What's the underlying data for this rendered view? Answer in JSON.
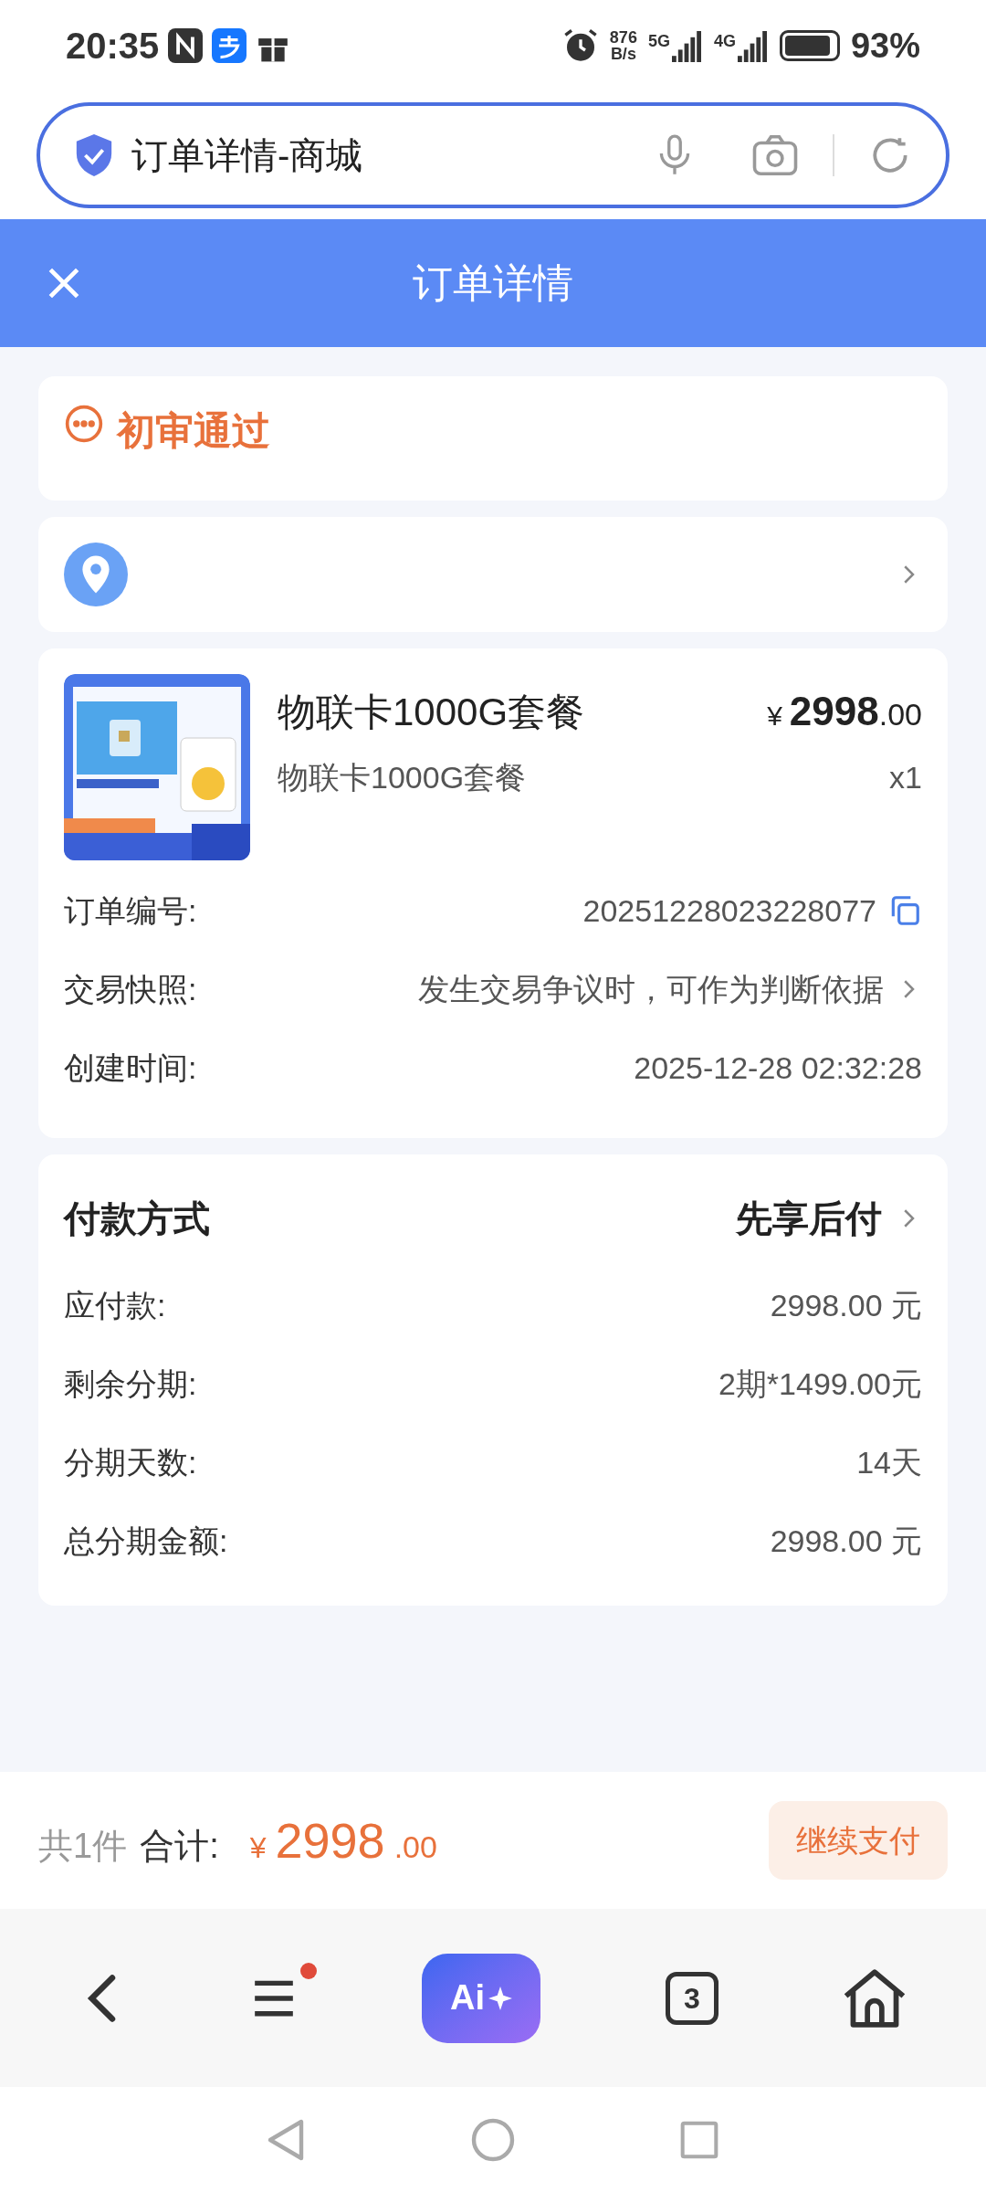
{
  "status_bar": {
    "time": "20:35",
    "net_speed": [
      "876",
      "B/s"
    ],
    "net1": "5G",
    "net2": "4G",
    "battery": "93%"
  },
  "address_bar": {
    "title": "订单详情-商城"
  },
  "header": {
    "title": "订单详情"
  },
  "status_card": {
    "text": "初审通过"
  },
  "product": {
    "name": "物联卡1000G套餐",
    "spec": "物联卡1000G套餐",
    "currency": "¥",
    "price_int": "2998",
    "price_dec": ".00",
    "qty": "x1"
  },
  "order_info": [
    {
      "label": "订单编号:",
      "value": "20251228023228077",
      "kind": "copy"
    },
    {
      "label": "交易快照:",
      "value": "发生交易争议时，可作为判断依据",
      "kind": "link"
    },
    {
      "label": "创建时间:",
      "value": "2025-12-28 02:32:28",
      "kind": "plain"
    }
  ],
  "payment": {
    "title": "付款方式",
    "method": "先享后付",
    "rows": [
      {
        "label": "应付款:",
        "value": "2998.00 元"
      },
      {
        "label": "剩余分期:",
        "value": "2期*1499.00元"
      },
      {
        "label": "分期天数:",
        "value": "14天"
      },
      {
        "label": "总分期金额:",
        "value": "2998.00 元"
      }
    ]
  },
  "footer": {
    "count": "共1件",
    "total_label": "合计:",
    "currency": "¥",
    "total_int": "2998",
    "total_dec": ".00",
    "button": "继续支付"
  },
  "browser_nav": {
    "ai_label": "Ai",
    "tabs_count": "3",
    "menu_badge": true
  }
}
